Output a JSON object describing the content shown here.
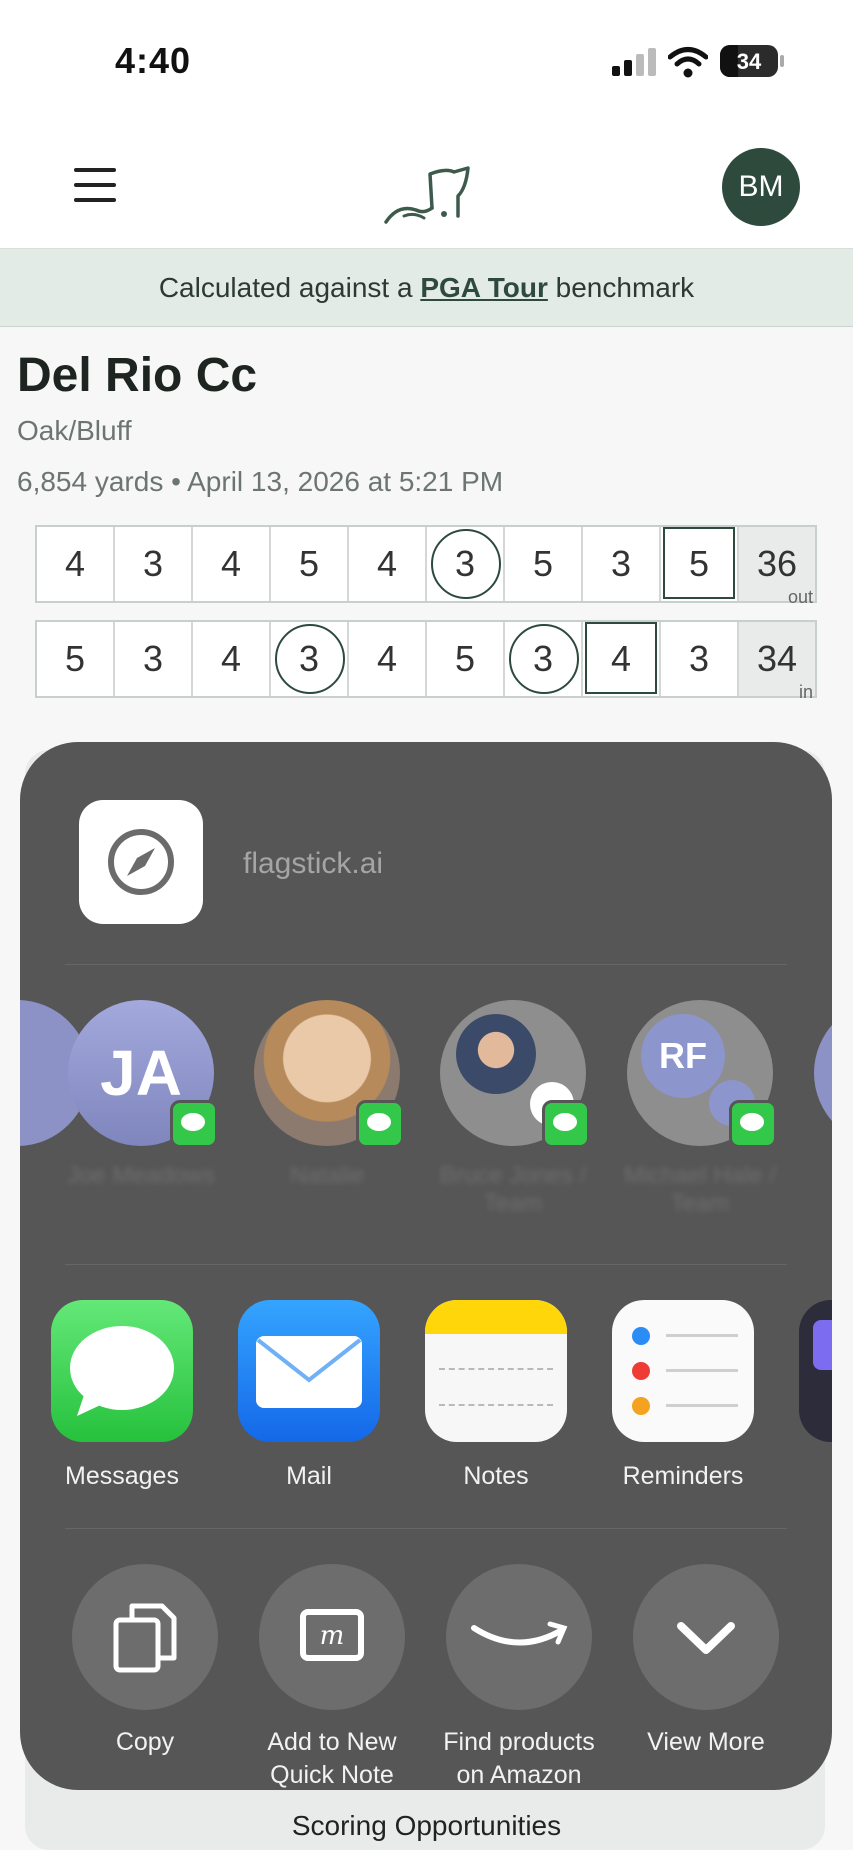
{
  "status_bar": {
    "time": "4:40",
    "battery": "34"
  },
  "header": {
    "avatar_initials": "BM"
  },
  "banner": {
    "prefix": "Calculated against a ",
    "link": "PGA Tour",
    "suffix": " benchmark"
  },
  "course": {
    "name": "Del Rio Cc",
    "tee": "Oak/Bluff",
    "meta": "6,854 yards • April 13, 2026 at 5:21 PM"
  },
  "scorecard": {
    "front": {
      "scores": [
        "4",
        "3",
        "4",
        "5",
        "4",
        "3",
        "5",
        "3",
        "5"
      ],
      "total": "36",
      "label": "out"
    },
    "back": {
      "scores": [
        "5",
        "3",
        "4",
        "3",
        "4",
        "5",
        "3",
        "4",
        "3"
      ],
      "total": "34",
      "label": "in"
    }
  },
  "below_sheet_text": "Scoring Opportunities",
  "share_sheet": {
    "site": "flagstick.ai",
    "contacts": [
      {
        "initials": "JA",
        "name": "Joe Meadows"
      },
      {
        "initials": "",
        "name": "Natalie"
      },
      {
        "initials": "",
        "name": "Bruce Jones / Team"
      },
      {
        "initials": "RF",
        "name": "Michael Hale / Team"
      }
    ],
    "apps": [
      "Messages",
      "Mail",
      "Notes",
      "Reminders"
    ],
    "actions": [
      {
        "line1": "Copy",
        "line2": ""
      },
      {
        "line1": "Add to New",
        "line2": "Quick Note"
      },
      {
        "line1": "Find products",
        "line2": "on Amazon"
      },
      {
        "line1": "View More",
        "line2": ""
      }
    ]
  },
  "colors": {
    "accent": "#2e4a3d",
    "sheet": "#565656",
    "messages_green": "#34c84a",
    "mail_blue": "#1f7cf5"
  }
}
